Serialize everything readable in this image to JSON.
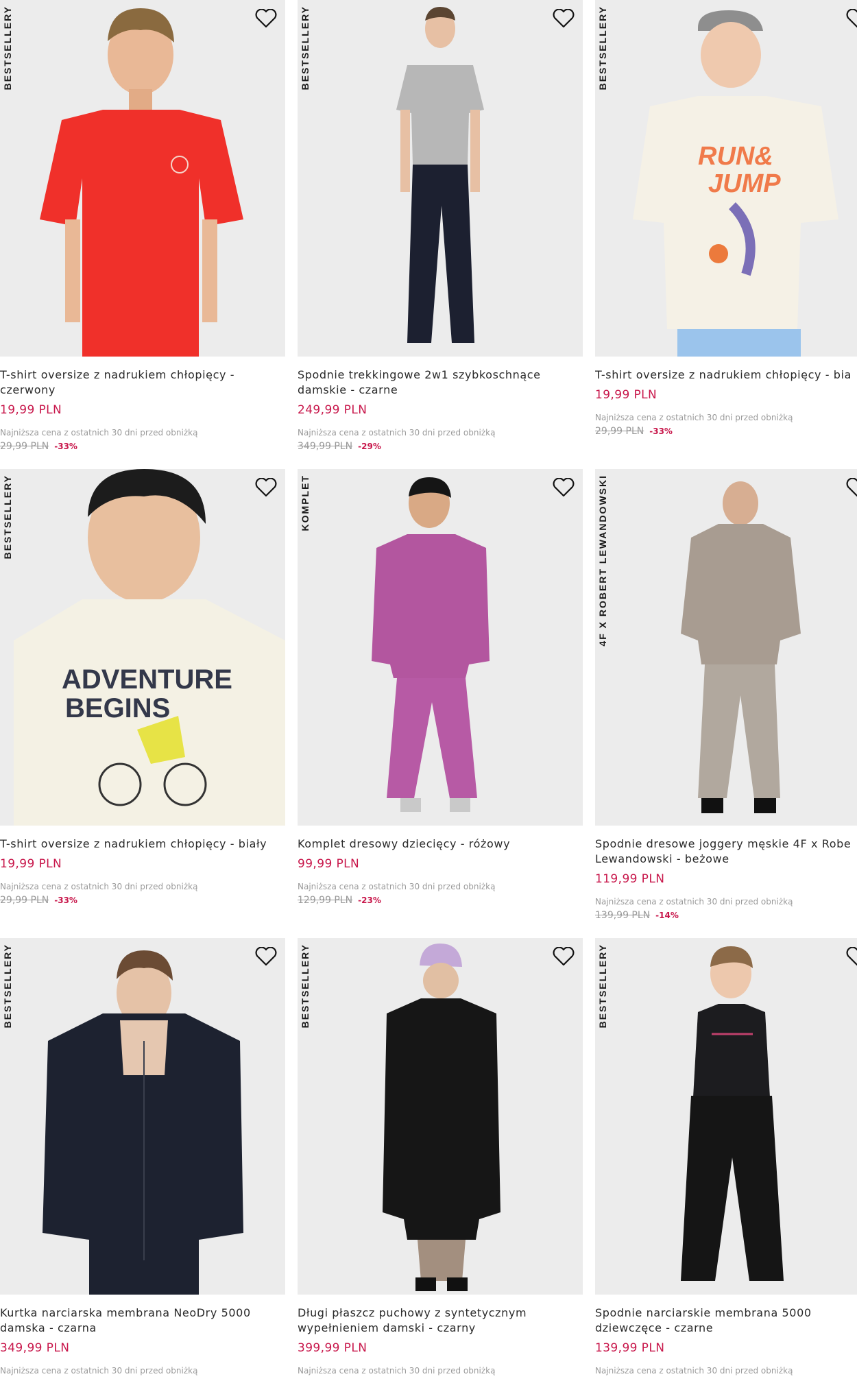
{
  "colors": {
    "price": "#c8174b",
    "muted": "#9a9a9a",
    "tile_bg": "#ebebeb"
  },
  "products": [
    {
      "badge": "BESTSELLERY",
      "title": "T-shirt oversize z nadrukiem chłopięcy - czerwony",
      "price": "19,99 PLN",
      "lowest_label": "Najniższa cena z ostatnich 30 dni przed obniżką",
      "old_price": "29,99 PLN",
      "discount": "-33%",
      "figure": "boy-red-tshirt"
    },
    {
      "badge": "BESTSELLERY",
      "title": "Spodnie trekkingowe 2w1 szybkoschnące damskie - czarne",
      "price": "249,99 PLN",
      "lowest_label": "Najniższa cena z ostatnich 30 dni przed obniżką",
      "old_price": "349,99 PLN",
      "discount": "-29%",
      "figure": "woman-grey-tee-black-pants"
    },
    {
      "badge": "BESTSELLERY",
      "title": "T-shirt oversize z nadrukiem chłopięcy - bia",
      "price": "19,99 PLN",
      "lowest_label": "Najniższa cena z ostatnich 30 dni przed obniżką",
      "old_price": "29,99 PLN",
      "discount": "-33%",
      "figure": "boy-white-tshirt-cap"
    },
    {
      "badge": "BESTSELLERY",
      "title": "T-shirt oversize z nadrukiem chłopięcy - biały",
      "price": "19,99 PLN",
      "lowest_label": "Najniższa cena z ostatnich 30 dni przed obniżką",
      "old_price": "29,99 PLN",
      "discount": "-33%",
      "figure": "boy-adventure-tshirt"
    },
    {
      "badge": "KOMPLET",
      "title": "Komplet dresowy dziecięcy - różowy",
      "price": "99,99 PLN",
      "lowest_label": "Najniższa cena z ostatnich 30 dni przed obniżką",
      "old_price": "129,99 PLN",
      "discount": "-23%",
      "figure": "kid-pink-tracksuit"
    },
    {
      "badge": "4F X ROBERT LEWANDOWSKI",
      "title": "Spodnie dresowe joggery męskie 4F x Robe Lewandowski - beżowe",
      "price": "119,99 PLN",
      "lowest_label": "Najniższa cena z ostatnich 30 dni przed obniżką",
      "old_price": "139,99 PLN",
      "discount": "-14%",
      "figure": "man-beige-tracksuit"
    },
    {
      "badge": "BESTSELLERY",
      "title": "Kurtka narciarska membrana NeoDry 5000 damska - czarna",
      "price": "349,99 PLN",
      "lowest_label": "Najniższa cena z ostatnich 30 dni przed obniżką",
      "old_price": "",
      "discount": "",
      "figure": "woman-black-ski-jacket"
    },
    {
      "badge": "BESTSELLERY",
      "title": "Długi płaszcz puchowy z syntetycznym wypełnieniem damski - czarny",
      "price": "399,99 PLN",
      "lowest_label": "Najniższa cena z ostatnich 30 dni przed obniżką",
      "old_price": "",
      "discount": "",
      "figure": "woman-long-black-coat"
    },
    {
      "badge": "BESTSELLERY",
      "title": "Spodnie narciarskie membrana 5000 dziewczęce - czarne",
      "price": "139,99 PLN",
      "lowest_label": "Najniższa cena z ostatnich 30 dni przed obniżką",
      "old_price": "",
      "discount": "",
      "figure": "girl-black-ski-pants"
    }
  ]
}
